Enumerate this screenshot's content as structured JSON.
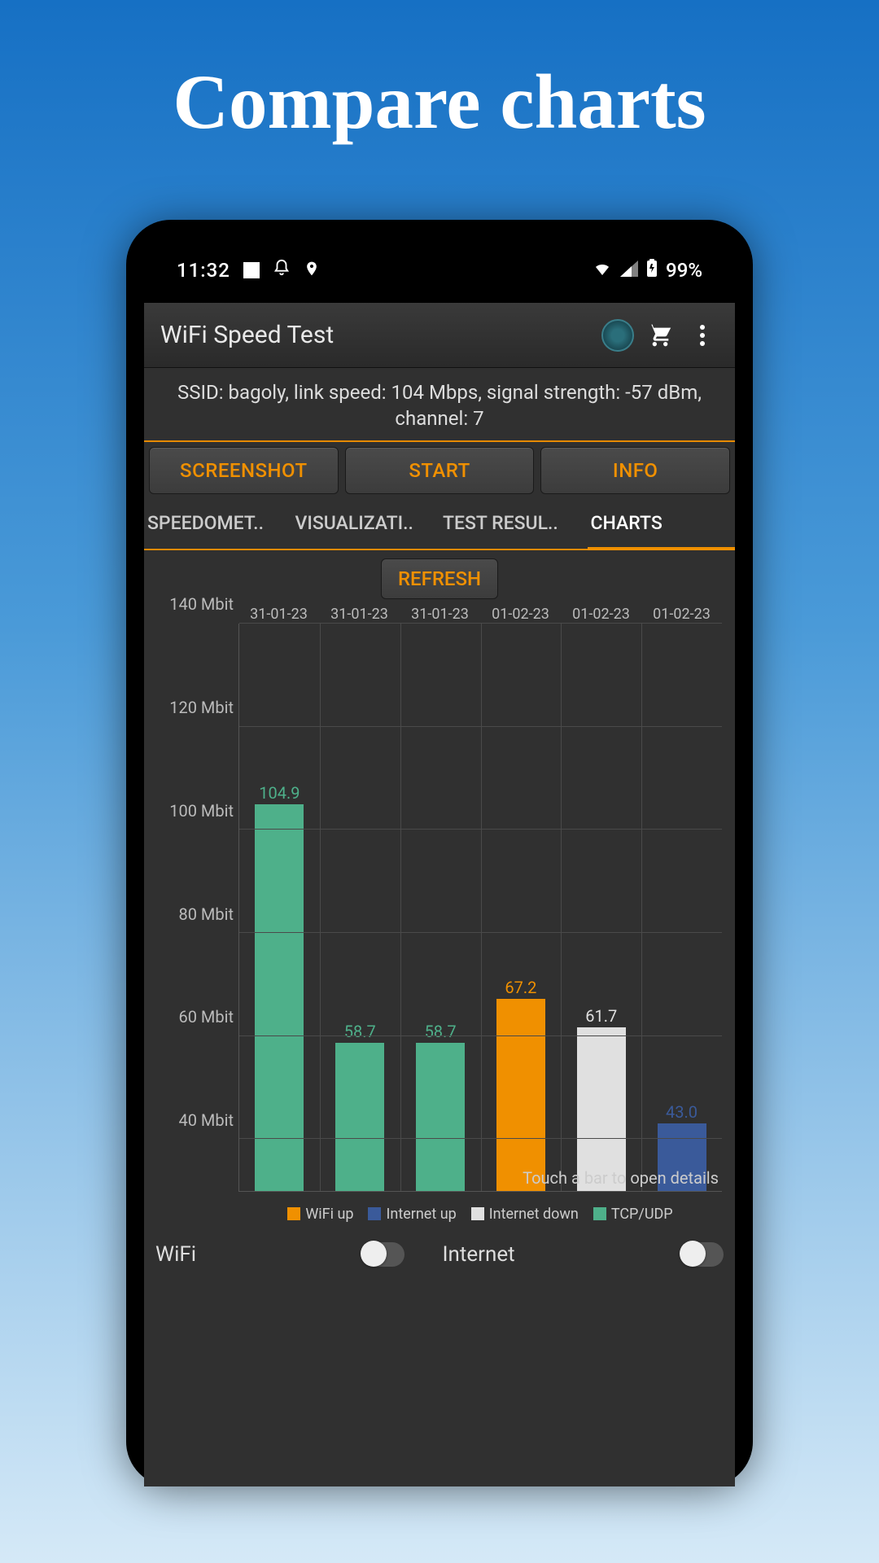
{
  "promo_title": "Compare charts",
  "status": {
    "time": "11:32",
    "battery": "99%"
  },
  "app": {
    "title": "WiFi Speed Test"
  },
  "ssid_text": "SSID: bagoly, link speed: 104 Mbps, signal strength: -57 dBm, channel: 7",
  "buttons": {
    "screenshot": "SCREENSHOT",
    "start": "START",
    "info": "INFO"
  },
  "tabs": {
    "speedometer": "SPEEDOMET..",
    "visualization": "VISUALIZATI..",
    "results": "TEST RESUL..",
    "charts": "CHARTS"
  },
  "refresh": "REFRESH",
  "hint": "Touch a bar to open details",
  "legend": {
    "wifi_up": "WiFi up",
    "internet_up": "Internet up",
    "internet_down": "Internet down",
    "tcp_udp": "TCP/UDP"
  },
  "toggles": {
    "wifi": "WiFi",
    "internet": "Internet"
  },
  "chart_data": {
    "type": "bar",
    "ylabel": "Mbit",
    "ylim": [
      30,
      140
    ],
    "y_ticks": [
      40,
      60,
      80,
      100,
      120,
      140
    ],
    "y_tick_labels": [
      "40 Mbit",
      "60 Mbit",
      "80 Mbit",
      "100 Mbit",
      "120 Mbit",
      "140 Mbit"
    ],
    "categories": [
      "31-01-23",
      "31-01-23",
      "31-01-23",
      "01-02-23",
      "01-02-23",
      "01-02-23"
    ],
    "bars": [
      {
        "value": 104.9,
        "label": "104.9",
        "series": "tcp_udp",
        "color": "#4eb08a",
        "label_color": "#4eb08a"
      },
      {
        "value": 58.7,
        "label": "58.7",
        "series": "tcp_udp",
        "color": "#4eb08a",
        "label_color": "#4eb08a"
      },
      {
        "value": 58.7,
        "label": "58.7",
        "series": "tcp_udp",
        "color": "#4eb08a",
        "label_color": "#4eb08a"
      },
      {
        "value": 67.2,
        "label": "67.2",
        "series": "wifi_up",
        "color": "#f09000",
        "label_color": "#f09000"
      },
      {
        "value": 61.7,
        "label": "61.7",
        "series": "internet_down",
        "color": "#e0e0e0",
        "label_color": "#e0e0e0"
      },
      {
        "value": 43.0,
        "label": "43.0",
        "series": "internet_up",
        "color": "#3a5a9a",
        "label_color": "#3a5a9a"
      }
    ],
    "legend_colors": {
      "wifi_up": "#f09000",
      "internet_up": "#3a5a9a",
      "internet_down": "#e0e0e0",
      "tcp_udp": "#4eb08a"
    }
  }
}
